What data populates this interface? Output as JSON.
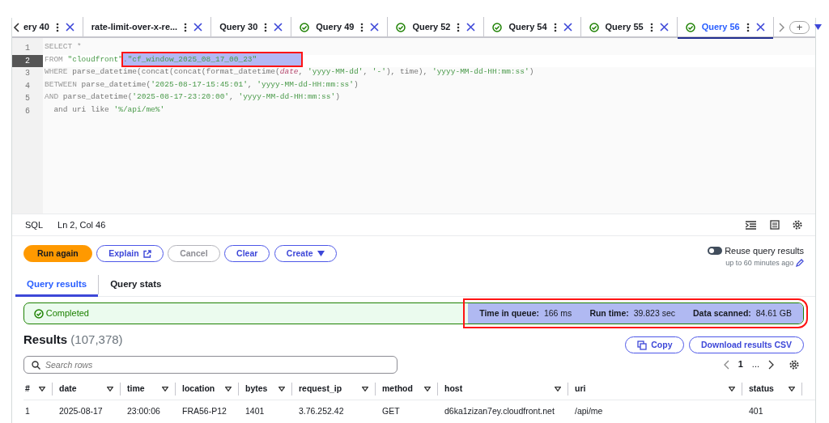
{
  "query_tabs": [
    {
      "label": "ery 40",
      "succeeded": false,
      "selected": false
    },
    {
      "label": "rate-limit-over-x-re...",
      "succeeded": false,
      "selected": false
    },
    {
      "label": "Query 30",
      "succeeded": false,
      "selected": false
    },
    {
      "label": "Query 49",
      "succeeded": true,
      "selected": false
    },
    {
      "label": "Query 52",
      "succeeded": true,
      "selected": false
    },
    {
      "label": "Query 54",
      "succeeded": true,
      "selected": false
    },
    {
      "label": "Query 55",
      "succeeded": true,
      "selected": false
    },
    {
      "label": "Query 56",
      "succeeded": true,
      "selected": true
    }
  ],
  "add_tab": "+",
  "editor": {
    "lines": [
      {
        "number": "1",
        "current": false,
        "tokens": [
          {
            "kind": "keyword",
            "text": "SELECT *"
          }
        ]
      },
      {
        "number": "2",
        "current": true,
        "tokens": [
          {
            "kind": "keyword",
            "text": "FROM "
          },
          {
            "kind": "string",
            "text": "\"cloudfront\""
          },
          {
            "kind": "plain",
            "text": ".",
            "highlighted": true
          },
          {
            "kind": "string",
            "text": "\"cf_window_2025_08_17_00_23\"",
            "highlighted": true
          }
        ]
      },
      {
        "number": "3",
        "current": false,
        "tokens": [
          {
            "kind": "keyword",
            "text": "WHERE "
          },
          {
            "kind": "plain",
            "text": "parse_datetime(concat(concat(format_datetime("
          },
          {
            "kind": "column",
            "text": "date"
          },
          {
            "kind": "plain",
            "text": ", "
          },
          {
            "kind": "string",
            "text": "'yyyy-MM-dd'"
          },
          {
            "kind": "plain",
            "text": ", "
          },
          {
            "kind": "string",
            "text": "'-'"
          },
          {
            "kind": "plain",
            "text": "), time), "
          },
          {
            "kind": "string",
            "text": "'yyyy-MM-dd-HH:mm:ss'"
          },
          {
            "kind": "plain",
            "text": ")"
          }
        ]
      },
      {
        "number": "4",
        "current": false,
        "tokens": [
          {
            "kind": "keyword",
            "text": "BETWEEN "
          },
          {
            "kind": "plain",
            "text": "parse_datetime("
          },
          {
            "kind": "string",
            "text": "'2025-08-17-15:45:01'"
          },
          {
            "kind": "plain",
            "text": ", "
          },
          {
            "kind": "string",
            "text": "'yyyy-MM-dd-HH:mm:ss'"
          },
          {
            "kind": "plain",
            "text": ")"
          }
        ]
      },
      {
        "number": "5",
        "current": false,
        "tokens": [
          {
            "kind": "keyword",
            "text": "AND "
          },
          {
            "kind": "plain",
            "text": "parse_datetime("
          },
          {
            "kind": "string",
            "text": "'2025-08-17-23:20:00'"
          },
          {
            "kind": "plain",
            "text": ", "
          },
          {
            "kind": "string",
            "text": "'yyyy-MM-dd-HH:mm:ss'"
          },
          {
            "kind": "plain",
            "text": ")"
          }
        ]
      },
      {
        "number": "6",
        "current": false,
        "tokens": [
          {
            "kind": "plain",
            "text": "  and uri like "
          },
          {
            "kind": "string",
            "text": "'%/api/me%'"
          }
        ]
      }
    ]
  },
  "status_bar": {
    "language": "SQL",
    "position": "Ln 2, Col 46"
  },
  "actions": [
    {
      "label": "Run again",
      "kind": "primary",
      "disabled": false
    },
    {
      "label": "Explain",
      "kind": "external",
      "disabled": false
    },
    {
      "label": "Cancel",
      "kind": "plain",
      "disabled": true
    },
    {
      "label": "Clear",
      "kind": "plain",
      "disabled": false
    },
    {
      "label": "Create",
      "kind": "dropdown",
      "disabled": false
    }
  ],
  "reuse": {
    "label": "Reuse query results",
    "on": false,
    "hint": "up to 60 minutes ago"
  },
  "result_tabs": [
    {
      "label": "Query results",
      "selected": true
    },
    {
      "label": "Query stats",
      "selected": false
    }
  ],
  "status": {
    "label": "Completed",
    "highlighted": true,
    "stats": [
      {
        "label": "Time in queue:",
        "value": "166 ms"
      },
      {
        "label": "Run time:",
        "value": "39.823 sec"
      },
      {
        "label": "Data scanned:",
        "value": "84.61 GB"
      }
    ]
  },
  "results": {
    "title": "Results",
    "count": "(107,378)",
    "copy": "Copy",
    "download": "Download results CSV",
    "search": {
      "placeholder": "Search rows"
    },
    "page": "1",
    "ellipsis": "...",
    "columns": [
      "#",
      "date",
      "time",
      "location",
      "bytes",
      "request_ip",
      "method",
      "host",
      "uri",
      "status"
    ],
    "rows": [
      [
        "1",
        "2025-08-17",
        "23:00:06",
        "FRA56-P12",
        "1401",
        "3.76.252.42",
        "GET",
        "d6ka1zizan7ey.cloudfront.net",
        "/api/me",
        "401"
      ]
    ]
  }
}
